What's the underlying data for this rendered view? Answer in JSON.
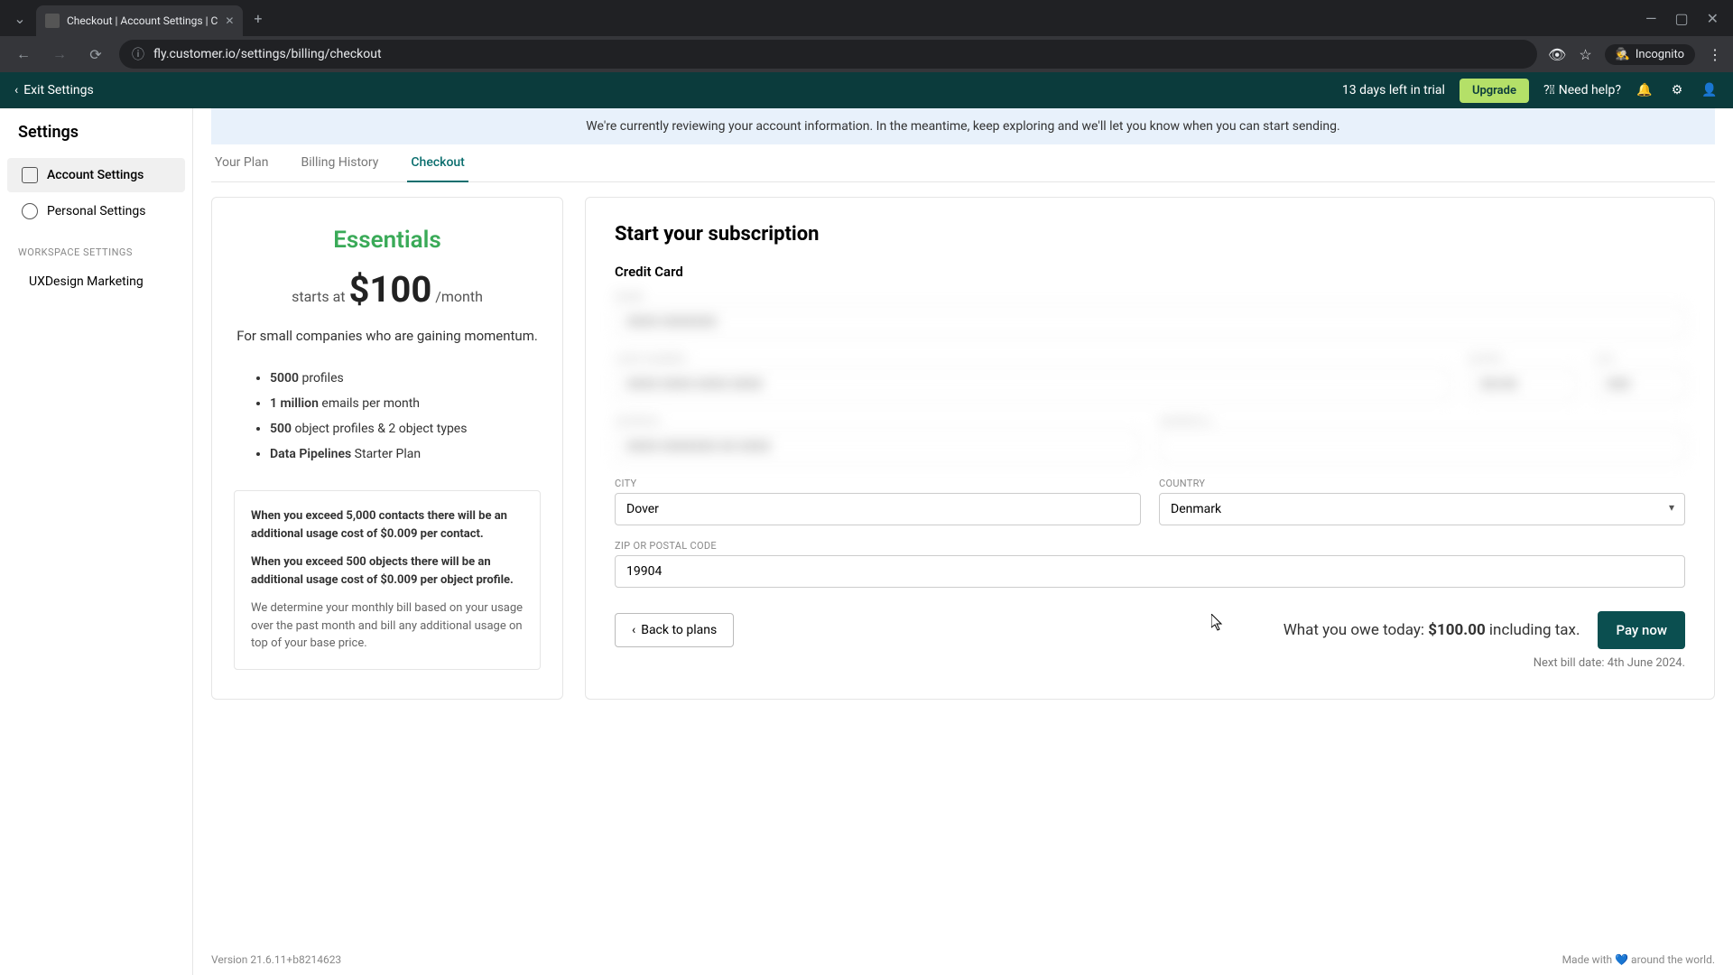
{
  "browser": {
    "tab_title": "Checkout | Account Settings | C",
    "url": "fly.customer.io/settings/billing/checkout",
    "incognito_label": "Incognito"
  },
  "header": {
    "exit_label": "Exit Settings",
    "trial_text": "13 days left in trial",
    "upgrade_label": "Upgrade",
    "help_label": "Need help?"
  },
  "banner": {
    "text": "We're currently reviewing your account information. In the meantime, keep exploring and we'll let you know when you can start sending."
  },
  "sidebar": {
    "title": "Settings",
    "items": [
      {
        "label": "Account Settings"
      },
      {
        "label": "Personal Settings"
      }
    ],
    "section_label": "WORKSPACE SETTINGS",
    "workspace": "UXDesign Marketing"
  },
  "tabs": [
    {
      "label": "Your Plan"
    },
    {
      "label": "Billing History"
    },
    {
      "label": "Checkout"
    }
  ],
  "plan": {
    "name": "Essentials",
    "starts_at": "starts at",
    "price": "$100",
    "per": "/month",
    "desc": "For small companies who are gaining momentum.",
    "features": [
      {
        "bold": "5000",
        "rest": " profiles"
      },
      {
        "bold": "1 million",
        "rest": " emails per month"
      },
      {
        "bold": "500",
        "rest": " object profiles & 2 object types"
      },
      {
        "bold": "Data Pipelines",
        "rest": " Starter Plan"
      }
    ],
    "usage1": "When you exceed 5,000 contacts there will be an additional usage cost of $0.009 per contact.",
    "usage2": "When you exceed 500 objects there will be an additional usage cost of $0.009 per object profile.",
    "usage3": "We determine your monthly bill based on your usage over the past month and bill any additional usage on top of your base price."
  },
  "checkout": {
    "title": "Start your subscription",
    "cc_label": "Credit Card",
    "city_label": "CITY",
    "city_value": "Dover",
    "country_label": "COUNTRY",
    "country_value": "Denmark",
    "zip_label": "ZIP OR POSTAL CODE",
    "zip_value": "19904",
    "back_label": "Back to plans",
    "owe_prefix": "What you owe today: ",
    "owe_amount": "$100.00",
    "owe_suffix": " including tax.",
    "pay_label": "Pay now",
    "next_bill": "Next bill date: 4th June 2024."
  },
  "footer": {
    "version": "Version 21.6.11+b8214623",
    "made": "Made with 💙 around the world."
  }
}
